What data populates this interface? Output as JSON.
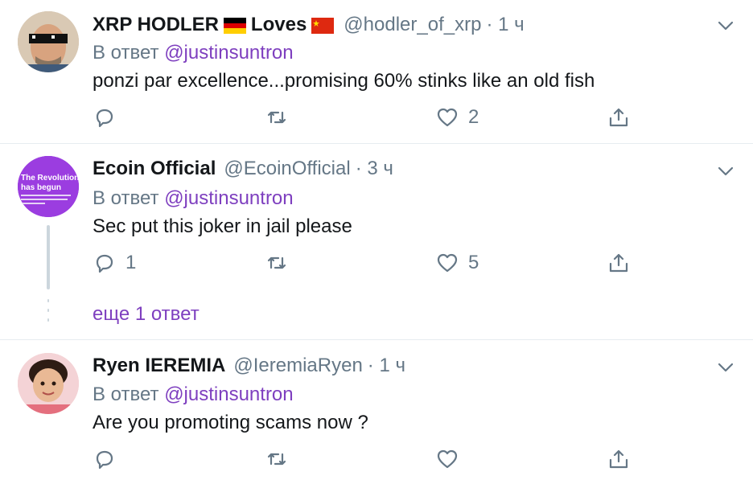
{
  "tweets": [
    {
      "name_part1": "XRP HODLER",
      "name_part2": "Loves",
      "handle": "@hodler_of_xrp",
      "time": "· 1 ч",
      "reply_prefix": "В ответ",
      "reply_mention": "@justinsuntron",
      "text": "ponzi par excellence...promising 60% stinks like an old fish",
      "replies": "",
      "retweets": "",
      "likes": "2"
    },
    {
      "name": "Ecoin Official",
      "handle": "@EcoinOfficial",
      "time": "· 3 ч",
      "avatar_text": "The Revolution has begun",
      "reply_prefix": "В ответ",
      "reply_mention": "@justinsuntron",
      "text": "Sec put this joker in jail please",
      "replies": "1",
      "retweets": "",
      "likes": "5",
      "more_replies": "еще 1 ответ"
    },
    {
      "name": "Ryen IEREMIA",
      "handle": "@IeremiaRyen",
      "time": "· 1 ч",
      "reply_prefix": "В ответ",
      "reply_mention": "@justinsuntron",
      "text": "Are you promoting scams now ?",
      "replies": "",
      "retweets": "",
      "likes": ""
    }
  ],
  "colors": {
    "text": "#14171a",
    "secondary": "#657786",
    "mention": "#7e3fbf",
    "divider": "#e6ecf0"
  },
  "icons": [
    "reply-icon",
    "retweet-icon",
    "like-icon",
    "share-icon",
    "chevron-down-icon",
    "germany-flag-icon",
    "china-flag-icon"
  ]
}
